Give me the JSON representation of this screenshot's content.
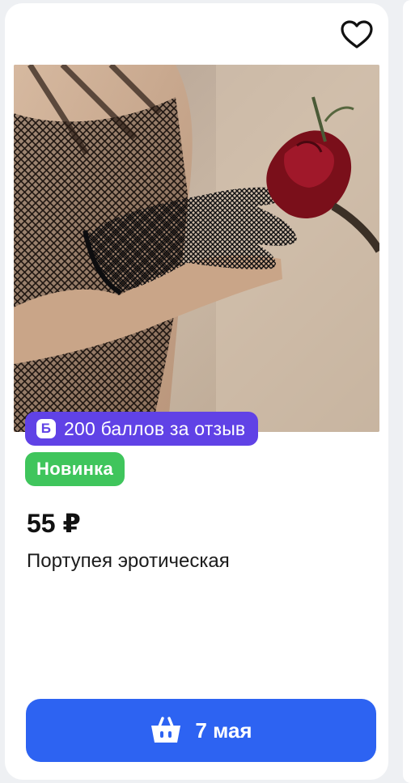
{
  "product": {
    "bonus_label": "200 баллов за отзыв",
    "bonus_icon_letter": "Б",
    "badge": "Новинка",
    "price": "55 ₽",
    "title": "Портупея эротическая",
    "favorite_icon": "heart-icon"
  },
  "cart_button": {
    "label": "7 мая",
    "icon": "basket-icon"
  },
  "colors": {
    "bonus_badge": "#6042e6",
    "new_badge": "#3fc55c",
    "cart_button": "#2d63f2"
  }
}
